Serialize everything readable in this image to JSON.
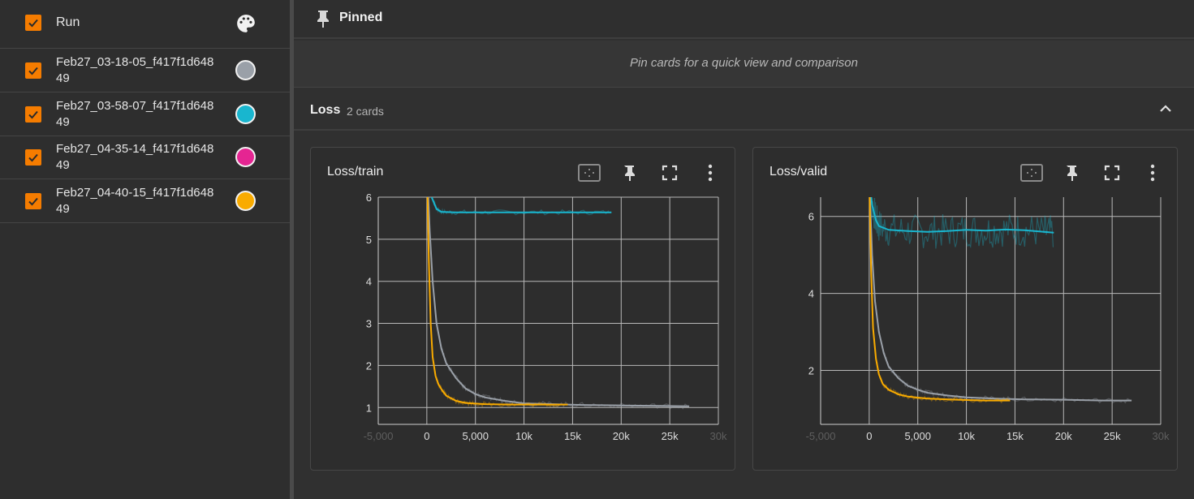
{
  "sidebar": {
    "header": {
      "label": "Run"
    },
    "runs": [
      {
        "name": "Feb27_03-18-05_f417f1d64849",
        "color": "#9aa0a8"
      },
      {
        "name": "Feb27_03-58-07_f417f1d64849",
        "color": "#19b6cf"
      },
      {
        "name": "Feb27_04-35-14_f417f1d64849",
        "color": "#e52592"
      },
      {
        "name": "Feb27_04-40-15_f417f1d64849",
        "color": "#f9ab00"
      }
    ],
    "icons": {
      "header": "palette-icon",
      "checkbox": "checkbox-checked-icon"
    }
  },
  "pinned": {
    "title": "Pinned",
    "empty_message": "Pin cards for a quick view and comparison",
    "icon": "pin-icon"
  },
  "group": {
    "title": "Loss",
    "count": "2 cards",
    "icon": "chevron-up-icon"
  },
  "cards": [
    {
      "title": "Loss/train",
      "actions": [
        "fit-domain-icon",
        "pin-icon",
        "fullscreen-icon",
        "more-vert-icon"
      ]
    },
    {
      "title": "Loss/valid",
      "actions": [
        "fit-domain-icon",
        "pin-icon",
        "fullscreen-icon",
        "more-vert-icon"
      ]
    }
  ],
  "chart_data": [
    {
      "type": "line",
      "title": "Loss/train",
      "xlim": [
        -5000,
        30000
      ],
      "ylim": [
        0.6,
        6.0
      ],
      "x_ticks": [
        "-5,000",
        "0",
        "5,000",
        "10k",
        "15k",
        "20k",
        "25k",
        "30k"
      ],
      "x_tick_values": [
        -5000,
        0,
        5000,
        10000,
        15000,
        20000,
        25000,
        30000
      ],
      "y_ticks": [
        "1",
        "2",
        "3",
        "4",
        "5",
        "6"
      ],
      "y_tick_values": [
        1,
        2,
        3,
        4,
        5,
        6
      ],
      "grid": true,
      "series": [
        {
          "color": "#19b6cf",
          "x": [
            0,
            500,
            1000,
            1500,
            3000,
            6000,
            10000,
            15000,
            19000
          ],
          "y": [
            6.8,
            6.0,
            5.72,
            5.65,
            5.64,
            5.64,
            5.64,
            5.64,
            5.64
          ]
        },
        {
          "color": "#9aa0a8",
          "x": [
            0,
            300,
            600,
            1000,
            1500,
            2000,
            3000,
            4000,
            5000,
            6000,
            8000,
            10000,
            13000,
            16000,
            20000,
            24000,
            27000
          ],
          "y": [
            6.8,
            5.2,
            4.0,
            3.0,
            2.4,
            2.05,
            1.7,
            1.45,
            1.32,
            1.24,
            1.16,
            1.1,
            1.08,
            1.06,
            1.05,
            1.04,
            1.03
          ]
        },
        {
          "color": "#f9ab00",
          "x": [
            0,
            200,
            400,
            600,
            900,
            1200,
            1600,
            2000,
            3000,
            4000,
            6000,
            9000,
            12000,
            14500
          ],
          "y": [
            6.8,
            4.5,
            3.0,
            2.2,
            1.75,
            1.55,
            1.4,
            1.28,
            1.16,
            1.11,
            1.08,
            1.07,
            1.07,
            1.07
          ]
        }
      ]
    },
    {
      "type": "line",
      "title": "Loss/valid",
      "xlim": [
        -5000,
        30000
      ],
      "ylim": [
        0.6,
        6.5
      ],
      "x_ticks": [
        "-5,000",
        "0",
        "5,000",
        "10k",
        "15k",
        "20k",
        "25k",
        "30k"
      ],
      "x_tick_values": [
        -5000,
        0,
        5000,
        10000,
        15000,
        20000,
        25000,
        30000
      ],
      "y_ticks": [
        "2",
        "4",
        "6"
      ],
      "y_tick_values": [
        2,
        4,
        6
      ],
      "grid": true,
      "series": [
        {
          "color": "#19b6cf",
          "x": [
            0,
            300,
            700,
            1000,
            2000,
            4000,
            6000,
            8000,
            10000,
            12000,
            14000,
            16000,
            18000,
            19000
          ],
          "y": [
            7.0,
            6.3,
            5.9,
            5.75,
            5.65,
            5.62,
            5.6,
            5.62,
            5.65,
            5.63,
            5.66,
            5.64,
            5.6,
            5.58
          ]
        },
        {
          "color": "#9aa0a8",
          "x": [
            0,
            300,
            600,
            1000,
            1500,
            2000,
            3000,
            4000,
            5000,
            6000,
            8000,
            10000,
            13000,
            16000,
            20000,
            24000,
            27000
          ],
          "y": [
            7.0,
            5.0,
            3.8,
            3.0,
            2.45,
            2.1,
            1.8,
            1.6,
            1.5,
            1.42,
            1.35,
            1.3,
            1.27,
            1.25,
            1.24,
            1.22,
            1.22
          ]
        },
        {
          "color": "#f9ab00",
          "x": [
            0,
            200,
            400,
            700,
            1000,
            1400,
            2000,
            3000,
            4000,
            6000,
            9000,
            12000,
            14500
          ],
          "y": [
            7.0,
            4.5,
            3.1,
            2.3,
            1.9,
            1.65,
            1.5,
            1.38,
            1.32,
            1.27,
            1.24,
            1.22,
            1.22
          ]
        }
      ]
    }
  ]
}
